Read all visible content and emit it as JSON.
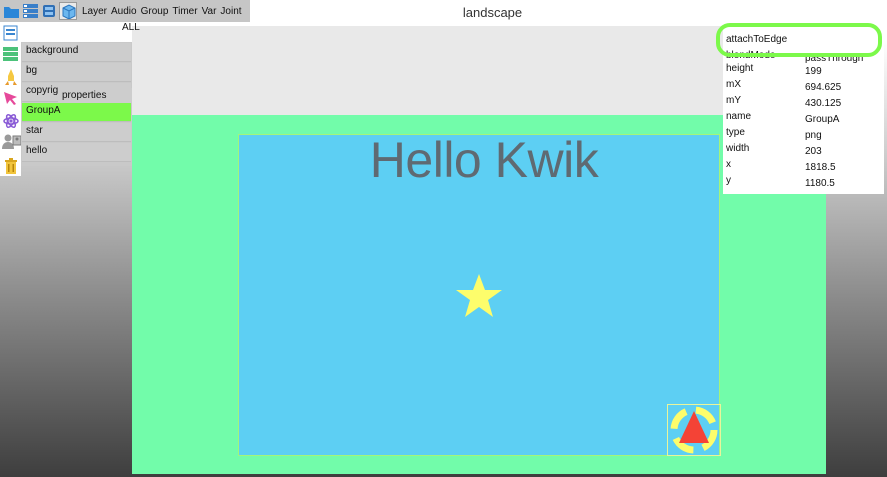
{
  "window": {
    "title": "landscape"
  },
  "toolbar": {
    "tabs": [
      "Layer",
      "Audio",
      "Group",
      "Timer",
      "Var",
      "Joint"
    ],
    "filter_label": "ALL"
  },
  "left_tools": [
    "page-icon",
    "list-icon",
    "rocket-icon",
    "pointer-icon",
    "atom-icon",
    "users-icon",
    "trash-icon"
  ],
  "layers": {
    "items": [
      "background",
      "bg",
      "copyrig",
      "GroupA",
      "star",
      "hello"
    ],
    "selected": "GroupA",
    "properties_label": "properties"
  },
  "properties": {
    "highlighted": "attachToEdge",
    "rows": [
      {
        "name": "blendMode",
        "value": "passThrough"
      },
      {
        "name": "height",
        "value": "199"
      },
      {
        "name": "mX",
        "value": "694.625"
      },
      {
        "name": "mY",
        "value": "430.125"
      },
      {
        "name": "name",
        "value": "GroupA"
      },
      {
        "name": "type",
        "value": "png"
      },
      {
        "name": "width",
        "value": "203"
      },
      {
        "name": "x",
        "value": "1818.5"
      },
      {
        "name": "y",
        "value": "1180.5"
      }
    ]
  },
  "canvas": {
    "heading": "Hello Kwik"
  },
  "colors": {
    "stage": "#72fcaa",
    "page": "#5dcff3",
    "selected": "#7cf94a",
    "star": "#fdfd6b",
    "triangle": "#f44336"
  }
}
